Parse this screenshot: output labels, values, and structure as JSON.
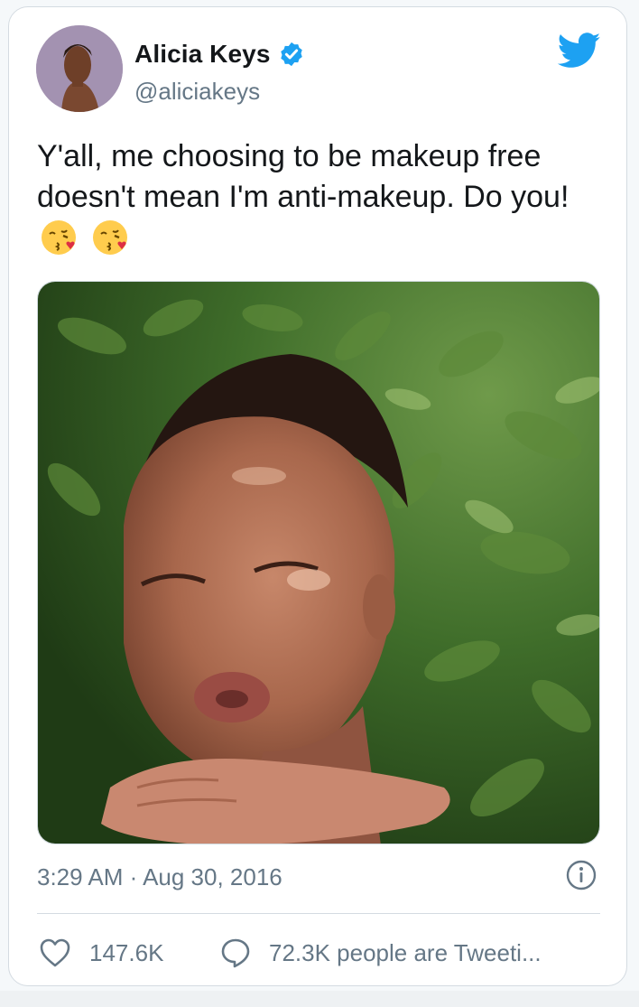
{
  "tweet": {
    "author": {
      "name": "Alicia Keys",
      "handle": "@aliciakeys",
      "verified": true,
      "avatar_icon": "profile-photo"
    },
    "text": "Y'all, me choosing to be makeup free doesn't mean I'm anti-makeup. Do you!",
    "emojis": [
      "face-throwing-a-kiss-emoji",
      "face-throwing-a-kiss-emoji"
    ],
    "media_description_icon": "photo",
    "timestamp": "3:29 AM · Aug 30, 2016",
    "likes": "147.6K",
    "replies_label": "72.3K people are Tweeti...",
    "brand_icon": "twitter-bird-icon"
  },
  "colors": {
    "brand": "#1da1f2",
    "text_primary": "#14171a",
    "text_secondary": "#657786",
    "border": "#d4dbe1"
  }
}
